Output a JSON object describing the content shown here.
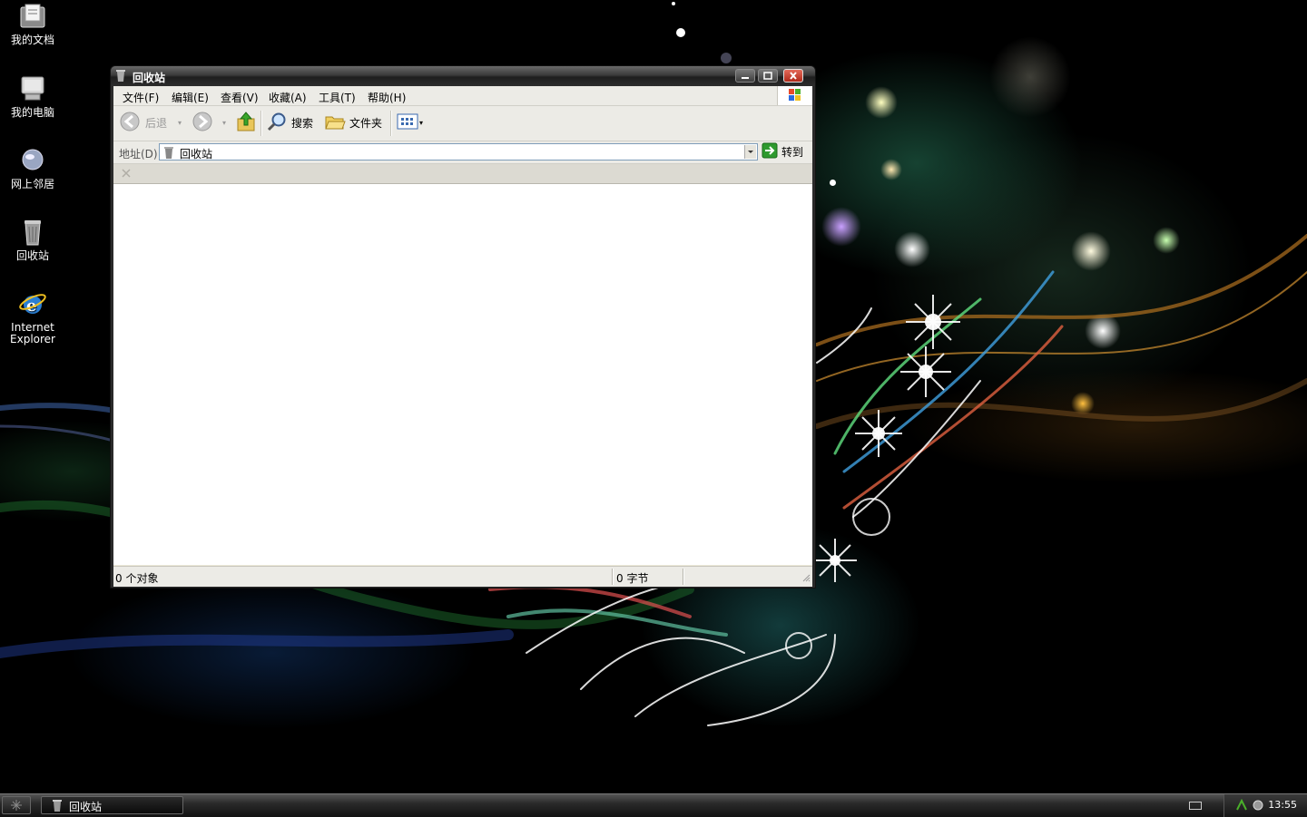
{
  "desktop": {
    "icons": [
      {
        "label": "我的文档"
      },
      {
        "label": "我的电脑"
      },
      {
        "label": "网上邻居"
      },
      {
        "label": "回收站"
      },
      {
        "label": "Internet Explorer"
      }
    ]
  },
  "window": {
    "title": "回收站",
    "menu": [
      "文件(F)",
      "编辑(E)",
      "查看(V)",
      "收藏(A)",
      "工具(T)",
      "帮助(H)"
    ],
    "toolbar": {
      "back": "后退",
      "search": "搜索",
      "folders": "文件夹"
    },
    "address": {
      "label": "地址(D)",
      "value": "回收站",
      "go": "转到"
    },
    "status": {
      "objects": "0 个对象",
      "size": "0 字节"
    }
  },
  "taskbar": {
    "task_label": "回收站",
    "clock": "13:55"
  },
  "colors": {
    "window_frame": "#2a2a2a",
    "chrome": "#ecebe6",
    "close_button": "#c8392a",
    "go_arrow": "#2e9a2e"
  }
}
